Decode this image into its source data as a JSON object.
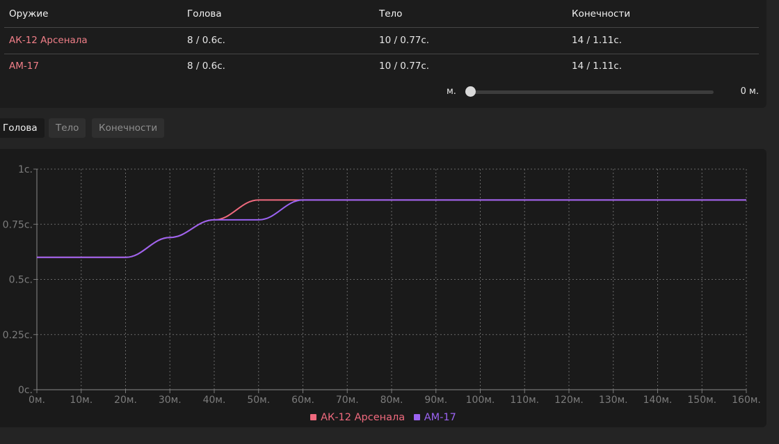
{
  "table": {
    "headers": [
      "Оружие",
      "Голова",
      "Тело",
      "Конечности"
    ],
    "rows": [
      {
        "weapon": "АК-12 Арсенала",
        "head": "8 / 0.6с.",
        "body": "10 / 0.77с.",
        "limbs": "14 / 1.11с."
      },
      {
        "weapon": "АМ-17",
        "head": "8 / 0.6с.",
        "body": "10 / 0.77с.",
        "limbs": "14 / 1.11с."
      }
    ]
  },
  "distance_slider": {
    "label": "м.",
    "value": 0,
    "value_text": "0 м.",
    "min": 0,
    "max": 160
  },
  "tabs": [
    {
      "label": "Голова",
      "active": true
    },
    {
      "label": "Тело",
      "active": false
    },
    {
      "label": "Конечности",
      "active": false
    }
  ],
  "chart_data": {
    "type": "line",
    "x": [
      0,
      10,
      20,
      30,
      40,
      50,
      60,
      70,
      80,
      90,
      100,
      110,
      120,
      130,
      140,
      150,
      160
    ],
    "x_tick_labels": [
      "0м.",
      "10м.",
      "20м.",
      "30м.",
      "40м.",
      "50м.",
      "60м.",
      "70м.",
      "80м.",
      "90м.",
      "100м.",
      "110м.",
      "120м.",
      "130м.",
      "140м.",
      "150м.",
      "160м."
    ],
    "y_ticks": [
      0,
      0.25,
      0.5,
      0.75,
      1
    ],
    "y_tick_labels": [
      "0с.",
      "0.25с.",
      "0.5с.",
      "0.75с.",
      "1с."
    ],
    "xlim": [
      0,
      160
    ],
    "ylim": [
      0,
      1
    ],
    "grid": true,
    "grid_style": "dotted",
    "legend_position": "bottom-center",
    "series": [
      {
        "name": "АК-12 Арсенала",
        "color": "#f06a7e",
        "points": [
          [
            0,
            0.6
          ],
          [
            20,
            0.6
          ],
          [
            30,
            0.69
          ],
          [
            40,
            0.77
          ],
          [
            50,
            0.86
          ],
          [
            60,
            0.86
          ],
          [
            160,
            0.86
          ]
        ]
      },
      {
        "name": "АМ-17",
        "color": "#9b63f2",
        "points": [
          [
            0,
            0.6
          ],
          [
            20,
            0.6
          ],
          [
            30,
            0.69
          ],
          [
            40,
            0.77
          ],
          [
            50,
            0.77
          ],
          [
            60,
            0.86
          ],
          [
            160,
            0.86
          ]
        ]
      }
    ]
  }
}
